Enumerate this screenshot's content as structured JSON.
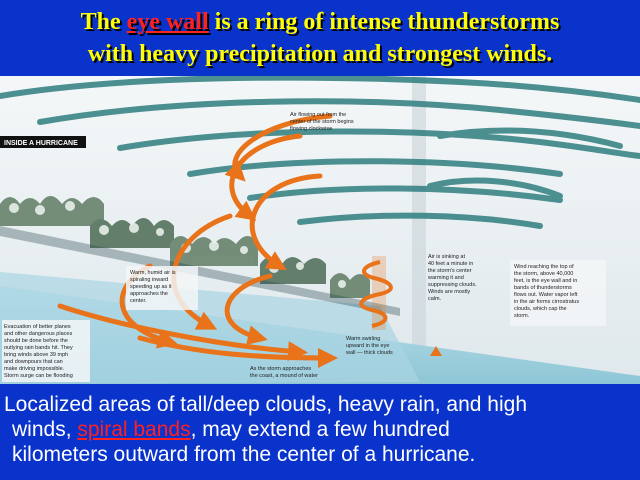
{
  "title": {
    "prefix": "The ",
    "highlight": "eye wall",
    "suffix_line1": " is a ring of intense thunderstorms",
    "line2": "with heavy precipitation and strongest winds."
  },
  "diagram": {
    "section_label": "INSIDE A HURRICANE",
    "annotations": {
      "top": [
        "Air flowing out from the",
        "center of the storm begins",
        "flowing clockwise"
      ],
      "warm_air": [
        "Warm, humid air is",
        "spiraling inward",
        "speeding up as it",
        "approaches the",
        "center."
      ],
      "sinking": [
        "Air is sinking at",
        "40 feet a minute in",
        "the storm's center",
        "warming it and",
        "suppressing clouds.",
        "Winds are mostly",
        "calm."
      ],
      "wind_top": [
        "Wind reaching the top of",
        "the storm, above 40,000",
        "feet, is the eye wall and in",
        "bands of thunderstorms",
        "flows out. Water vapor left",
        "in the air forms cirrostratus",
        "clouds, which cap the",
        "storm."
      ],
      "left_bottom": [
        "Evacuation of better planes",
        "and other dangerous places",
        "should be done before the",
        "outlying rain bands hit. They",
        "bring winds above 39 mph",
        "and downpours that can",
        "make driving impossible.",
        "Storm surge can be flooding"
      ],
      "approach": [
        "As the storm approaches",
        "the coast, a mound of water"
      ],
      "rising": [
        "Warm swirling",
        "upward in the eye",
        "wall — thick clouds"
      ]
    }
  },
  "caption": {
    "line1": "Localized areas of tall/deep clouds, heavy rain, and high",
    "line2_highlight": "spiral bands",
    "line2_suffix": ", may extend a few hundred",
    "line2_prefix": "winds, ",
    "line3": "kilometers outward from the center of a hurricane."
  },
  "colors": {
    "background": "#0a33cc",
    "title_text": "#ffff00",
    "highlight": "#ff2020",
    "caption_text": "#ffffff",
    "arrow": "#e8731a",
    "cloud_band": "#2f7e80",
    "sky": "#eef3f5"
  }
}
